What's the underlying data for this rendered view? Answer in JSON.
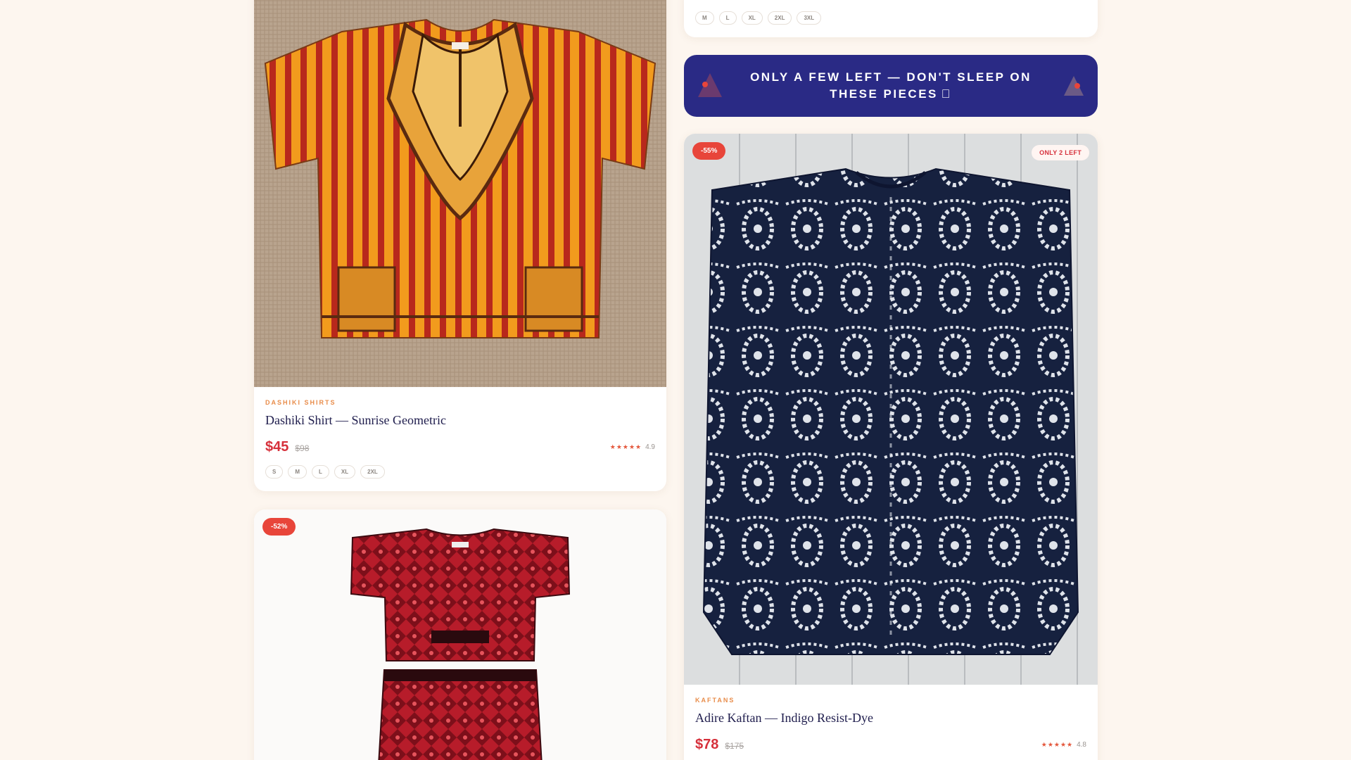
{
  "top_card": {
    "sizes": [
      "M",
      "L",
      "XL",
      "2XL",
      "3XL"
    ]
  },
  "banner": {
    "text": "ONLY A FEW LEFT — DON'T SLEEP ON THESE PIECES ⃞",
    "colors": {
      "background": "#2a2a85",
      "triangle_left": "#6b3a6e",
      "triangle_right": "#6b5a86",
      "dot": "#e8453a"
    }
  },
  "products": [
    {
      "category": "DASHIKI SHIRTS",
      "title": "Dashiki Shirt — Sunrise Geometric",
      "price": "$45",
      "old_price": "$98",
      "stars": "★★★★★",
      "rating": "4.9",
      "sizes": [
        "S",
        "M",
        "L",
        "XL",
        "2XL"
      ],
      "image_icon": "dashiki-shirt-image"
    },
    {
      "discount_badge": "-52%",
      "image_icon": "two-piece-set-image"
    },
    {
      "discount_badge": "-55%",
      "stock_badge": "ONLY 2 LEFT",
      "category": "KAFTANS",
      "title": "Adire Kaftan — Indigo Resist-Dye",
      "price": "$78",
      "old_price": "$175",
      "stars": "★★★★★",
      "rating": "4.8",
      "image_icon": "adire-kaftan-image"
    }
  ],
  "colors": {
    "page_background": "#fdf6ef",
    "accent_price": "#d6303b",
    "category": "#e88c4a",
    "title": "#1f1d4d",
    "discount": "#e8453a"
  }
}
